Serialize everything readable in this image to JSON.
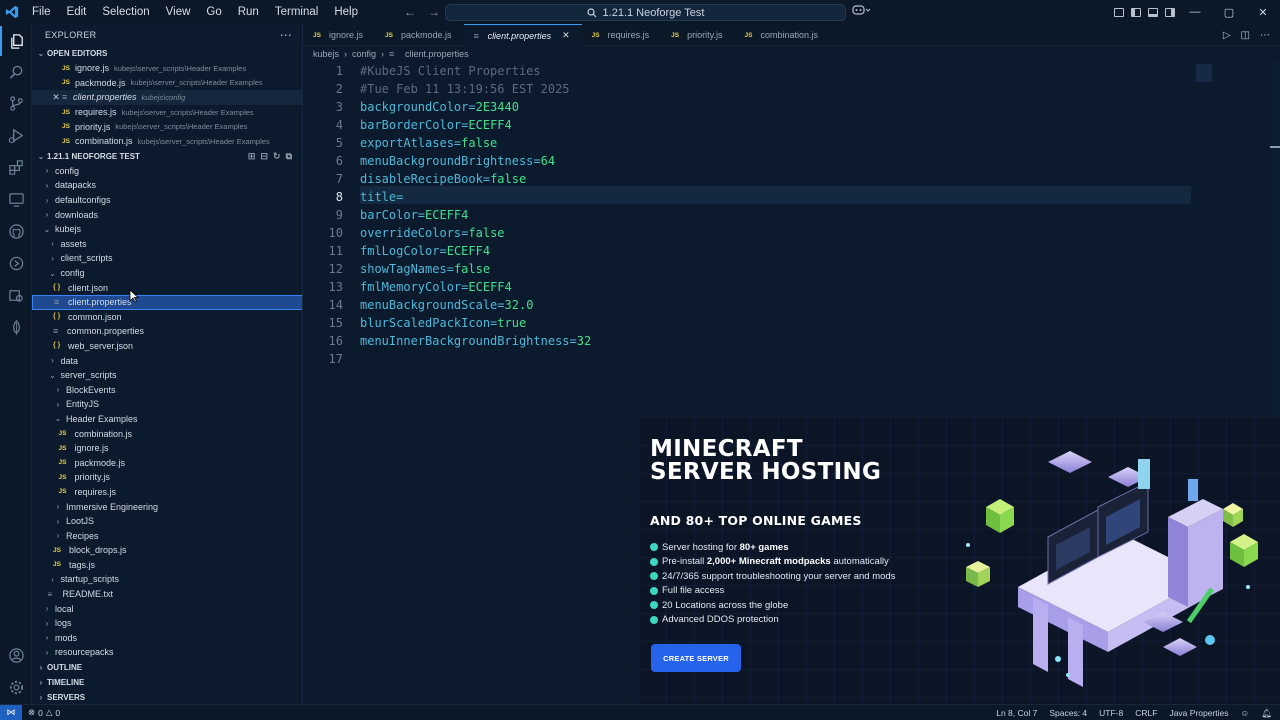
{
  "window": {
    "menu": [
      "File",
      "Edit",
      "Selection",
      "View",
      "Go",
      "Run",
      "Terminal",
      "Help"
    ],
    "command_center": "1.21.1 Neoforge Test"
  },
  "sidebar": {
    "title": "EXPLORER",
    "open_editors_label": "OPEN EDITORS",
    "open_editors": [
      {
        "name": "ignore.js",
        "path": "kubejs\\server_scripts\\Header Examples",
        "type": "js"
      },
      {
        "name": "packmode.js",
        "path": "kubejs\\server_scripts\\Header Examples",
        "type": "js"
      },
      {
        "name": "client.properties",
        "path": "kubejs\\config",
        "type": "prop"
      },
      {
        "name": "requires.js",
        "path": "kubejs\\server_scripts\\Header Examples",
        "type": "js"
      },
      {
        "name": "priority.js",
        "path": "kubejs\\server_scripts\\Header Examples",
        "type": "js"
      },
      {
        "name": "combination.js",
        "path": "kubejs\\server_scripts\\Header Examples",
        "type": "js"
      }
    ],
    "workspace_label": "1.21.1 NEOFORGE TEST",
    "tree": [
      {
        "label": "config",
        "depth": 0,
        "kind": "folder"
      },
      {
        "label": "datapacks",
        "depth": 0,
        "kind": "folder"
      },
      {
        "label": "defaultconfigs",
        "depth": 0,
        "kind": "folder"
      },
      {
        "label": "downloads",
        "depth": 0,
        "kind": "folder"
      },
      {
        "label": "kubejs",
        "depth": 0,
        "kind": "folder-open"
      },
      {
        "label": "assets",
        "depth": 1,
        "kind": "folder"
      },
      {
        "label": "client_scripts",
        "depth": 1,
        "kind": "folder"
      },
      {
        "label": "config",
        "depth": 1,
        "kind": "folder-open"
      },
      {
        "label": "client.json",
        "depth": 2,
        "kind": "json"
      },
      {
        "label": "client.properties",
        "depth": 2,
        "kind": "prop"
      },
      {
        "label": "common.json",
        "depth": 2,
        "kind": "json"
      },
      {
        "label": "common.properties",
        "depth": 2,
        "kind": "prop"
      },
      {
        "label": "web_server.json",
        "depth": 2,
        "kind": "json"
      },
      {
        "label": "data",
        "depth": 1,
        "kind": "folder"
      },
      {
        "label": "server_scripts",
        "depth": 1,
        "kind": "folder-open"
      },
      {
        "label": "BlockEvents",
        "depth": 2,
        "kind": "folder"
      },
      {
        "label": "EntityJS",
        "depth": 2,
        "kind": "folder"
      },
      {
        "label": "Header Examples",
        "depth": 2,
        "kind": "folder-open"
      },
      {
        "label": "combination.js",
        "depth": 3,
        "kind": "js"
      },
      {
        "label": "ignore.js",
        "depth": 3,
        "kind": "js"
      },
      {
        "label": "packmode.js",
        "depth": 3,
        "kind": "js"
      },
      {
        "label": "priority.js",
        "depth": 3,
        "kind": "js"
      },
      {
        "label": "requires.js",
        "depth": 3,
        "kind": "js"
      },
      {
        "label": "Immersive Engineering",
        "depth": 2,
        "kind": "folder"
      },
      {
        "label": "LootJS",
        "depth": 2,
        "kind": "folder"
      },
      {
        "label": "Recipes",
        "depth": 2,
        "kind": "folder"
      },
      {
        "label": "block_drops.js",
        "depth": 2,
        "kind": "js"
      },
      {
        "label": "tags.js",
        "depth": 2,
        "kind": "js"
      },
      {
        "label": "startup_scripts",
        "depth": 1,
        "kind": "folder"
      },
      {
        "label": "README.txt",
        "depth": 1,
        "kind": "txt"
      },
      {
        "label": "local",
        "depth": 0,
        "kind": "folder"
      },
      {
        "label": "logs",
        "depth": 0,
        "kind": "folder"
      },
      {
        "label": "mods",
        "depth": 0,
        "kind": "folder"
      },
      {
        "label": "resourcepacks",
        "depth": 0,
        "kind": "folder"
      }
    ],
    "selected_tree_index": 9,
    "bottom_sections": [
      "OUTLINE",
      "TIMELINE",
      "SERVERS"
    ]
  },
  "tabs": [
    {
      "label": "ignore.js",
      "type": "js",
      "active": false
    },
    {
      "label": "packmode.js",
      "type": "js",
      "active": false
    },
    {
      "label": "client.properties",
      "type": "prop",
      "active": true
    },
    {
      "label": "requires.js",
      "type": "js",
      "active": false
    },
    {
      "label": "priority.js",
      "type": "js",
      "active": false
    },
    {
      "label": "combination.js",
      "type": "js",
      "active": false
    }
  ],
  "breadcrumb": [
    "kubejs",
    "config",
    "client.properties"
  ],
  "editor": {
    "current_line": 8,
    "lines": [
      {
        "n": "1",
        "key": "#KubeJS Client Properties",
        "value": "",
        "comment": true
      },
      {
        "n": "2",
        "key": "#Tue Feb 11 13:19:56 EST 2025",
        "value": "",
        "comment": true
      },
      {
        "n": "3",
        "key": "backgroundColor",
        "value": "2E3440",
        "comment": false
      },
      {
        "n": "4",
        "key": "barBorderColor",
        "value": "ECEFF4",
        "comment": false
      },
      {
        "n": "5",
        "key": "exportAtlases",
        "value": "false",
        "comment": false
      },
      {
        "n": "6",
        "key": "menuBackgroundBrightness",
        "value": "64",
        "comment": false
      },
      {
        "n": "7",
        "key": "disableRecipeBook",
        "value": "false",
        "comment": false
      },
      {
        "n": "8",
        "key": "title",
        "value": "",
        "comment": false
      },
      {
        "n": "9",
        "key": "barColor",
        "value": "ECEFF4",
        "comment": false
      },
      {
        "n": "10",
        "key": "overrideColors",
        "value": "false",
        "comment": false
      },
      {
        "n": "11",
        "key": "fmlLogColor",
        "value": "ECEFF4",
        "comment": false
      },
      {
        "n": "12",
        "key": "showTagNames",
        "value": "false",
        "comment": false
      },
      {
        "n": "13",
        "key": "fmlMemoryColor",
        "value": "ECEFF4",
        "comment": false
      },
      {
        "n": "14",
        "key": "menuBackgroundScale",
        "value": "32.0",
        "comment": false
      },
      {
        "n": "15",
        "key": "blurScaledPackIcon",
        "value": "true",
        "comment": false
      },
      {
        "n": "16",
        "key": "menuInnerBackgroundBrightness",
        "value": "32",
        "comment": false
      },
      {
        "n": "17",
        "key": "",
        "value": "",
        "comment": true
      }
    ]
  },
  "ad": {
    "title": "MINECRAFT SERVER HOSTING",
    "subtitle": "AND 80+ TOP ONLINE GAMES",
    "features": [
      {
        "pre": "Server hosting for ",
        "bold": "80+ games",
        "post": ""
      },
      {
        "pre": "Pre-install ",
        "bold": "2,000+ Minecraft modpacks",
        "post": " automatically"
      },
      {
        "pre": "24/7/365 support troubleshooting your server and mods",
        "bold": "",
        "post": ""
      },
      {
        "pre": "Full file access",
        "bold": "",
        "post": ""
      },
      {
        "pre": "20 Locations across the globe",
        "bold": "",
        "post": ""
      },
      {
        "pre": "Advanced DDOS protection",
        "bold": "",
        "post": ""
      }
    ],
    "button": "CREATE SERVER"
  },
  "statusbar": {
    "problems": "0",
    "warnings": "0",
    "position": "Ln 8, Col 7",
    "spaces": "Spaces: 4",
    "encoding": "UTF-8",
    "eol": "CRLF",
    "language": "Java Properties"
  },
  "colors": {
    "accent": "#3b9bf0",
    "selection": "#1f4a92",
    "key": "#4fb8d9",
    "value": "#44e08c",
    "comment": "#5a6b7e",
    "ad_button": "#2563eb"
  }
}
